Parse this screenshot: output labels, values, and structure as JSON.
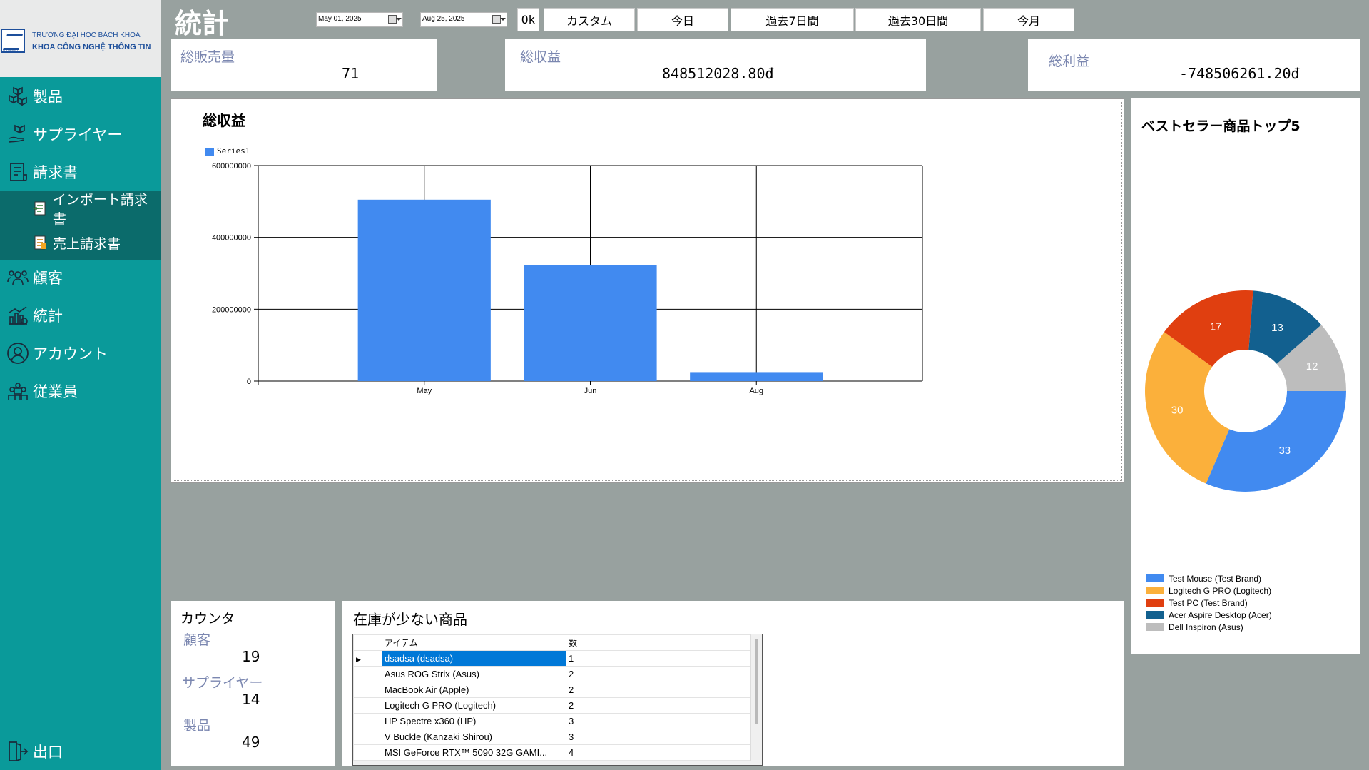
{
  "logo": {
    "line1": "TRƯỜNG ĐẠI HỌC BÁCH KHOA",
    "line2": "KHOA CÔNG NGHỆ THÔNG TIN"
  },
  "sidebar": {
    "items": [
      {
        "label": "製品",
        "icon": "boxes-icon"
      },
      {
        "label": "サプライヤー",
        "icon": "supplier-hand-icon"
      },
      {
        "label": "請求書",
        "icon": "invoice-icon"
      },
      {
        "label": "顧客",
        "icon": "customer-icon"
      },
      {
        "label": "統計",
        "icon": "statistics-icon"
      },
      {
        "label": "アカウント",
        "icon": "account-icon"
      },
      {
        "label": "従業員",
        "icon": "employees-icon"
      }
    ],
    "subitems": [
      {
        "label": "インポート請求書",
        "icon": "import-invoice-icon"
      },
      {
        "label": "売上請求書",
        "icon": "sales-invoice-icon"
      }
    ],
    "exit_label": "出口"
  },
  "header": {
    "title": "統計",
    "date_from": "May 01, 2025",
    "date_to": "Aug 25, 2025",
    "ok_label": "Ok",
    "buttons": [
      "カスタム",
      "今日",
      "過去7日間",
      "過去30日間",
      "今月"
    ]
  },
  "kpis": {
    "sales_label": "総販売量",
    "sales_value": "71",
    "revenue_label": "総収益",
    "revenue_value": "848512028.80đ",
    "profit_label": "総利益",
    "profit_value": "-748506261.20đ"
  },
  "chart_data": [
    {
      "type": "bar",
      "title": "総収益",
      "categories": [
        "May",
        "Jun",
        "Aug"
      ],
      "series": [
        {
          "name": "Series1",
          "values": [
            505000000,
            323000000,
            25000000
          ]
        }
      ],
      "ylim": [
        0,
        600000000
      ],
      "yticks": [
        "0",
        "200000000",
        "400000000",
        "600000000"
      ],
      "grid": true,
      "legend": "top-left",
      "color": "#418af0"
    },
    {
      "type": "pie",
      "title": "ベストセラー商品トップ5",
      "donut": true,
      "labels": [
        "Test Mouse (Test Brand)",
        "Logitech G PRO (Logitech)",
        "Test PC (Test Brand)",
        "Acer Aspire Desktop (Acer)",
        "Dell Inspiron (Asus)"
      ],
      "values": [
        33,
        30,
        17,
        13,
        12
      ],
      "colors": [
        "#418af0",
        "#fbb03b",
        "#e03f10",
        "#12608f",
        "#bdbdbd"
      ],
      "legend": "bottom"
    }
  ],
  "counter": {
    "title": "カウンタ",
    "customers_label": "顧客",
    "customers_value": "19",
    "suppliers_label": "サプライヤー",
    "suppliers_value": "14",
    "products_label": "製品",
    "products_value": "49"
  },
  "lowstock": {
    "title": "在庫が少ない商品",
    "columns": [
      "アイテム",
      "数"
    ],
    "rows": [
      [
        "dsadsa (dsadsa)",
        "1"
      ],
      [
        "Asus ROG Strix (Asus)",
        "2"
      ],
      [
        "MacBook Air (Apple)",
        "2"
      ],
      [
        "Logitech G PRO (Logitech)",
        "2"
      ],
      [
        "HP Spectre x360 (HP)",
        "3"
      ],
      [
        "V Buckle (Kanzaki Shirou)",
        "3"
      ],
      [
        "MSI GeForce RTX™ 5090 32G GAMI...",
        "4"
      ]
    ]
  }
}
